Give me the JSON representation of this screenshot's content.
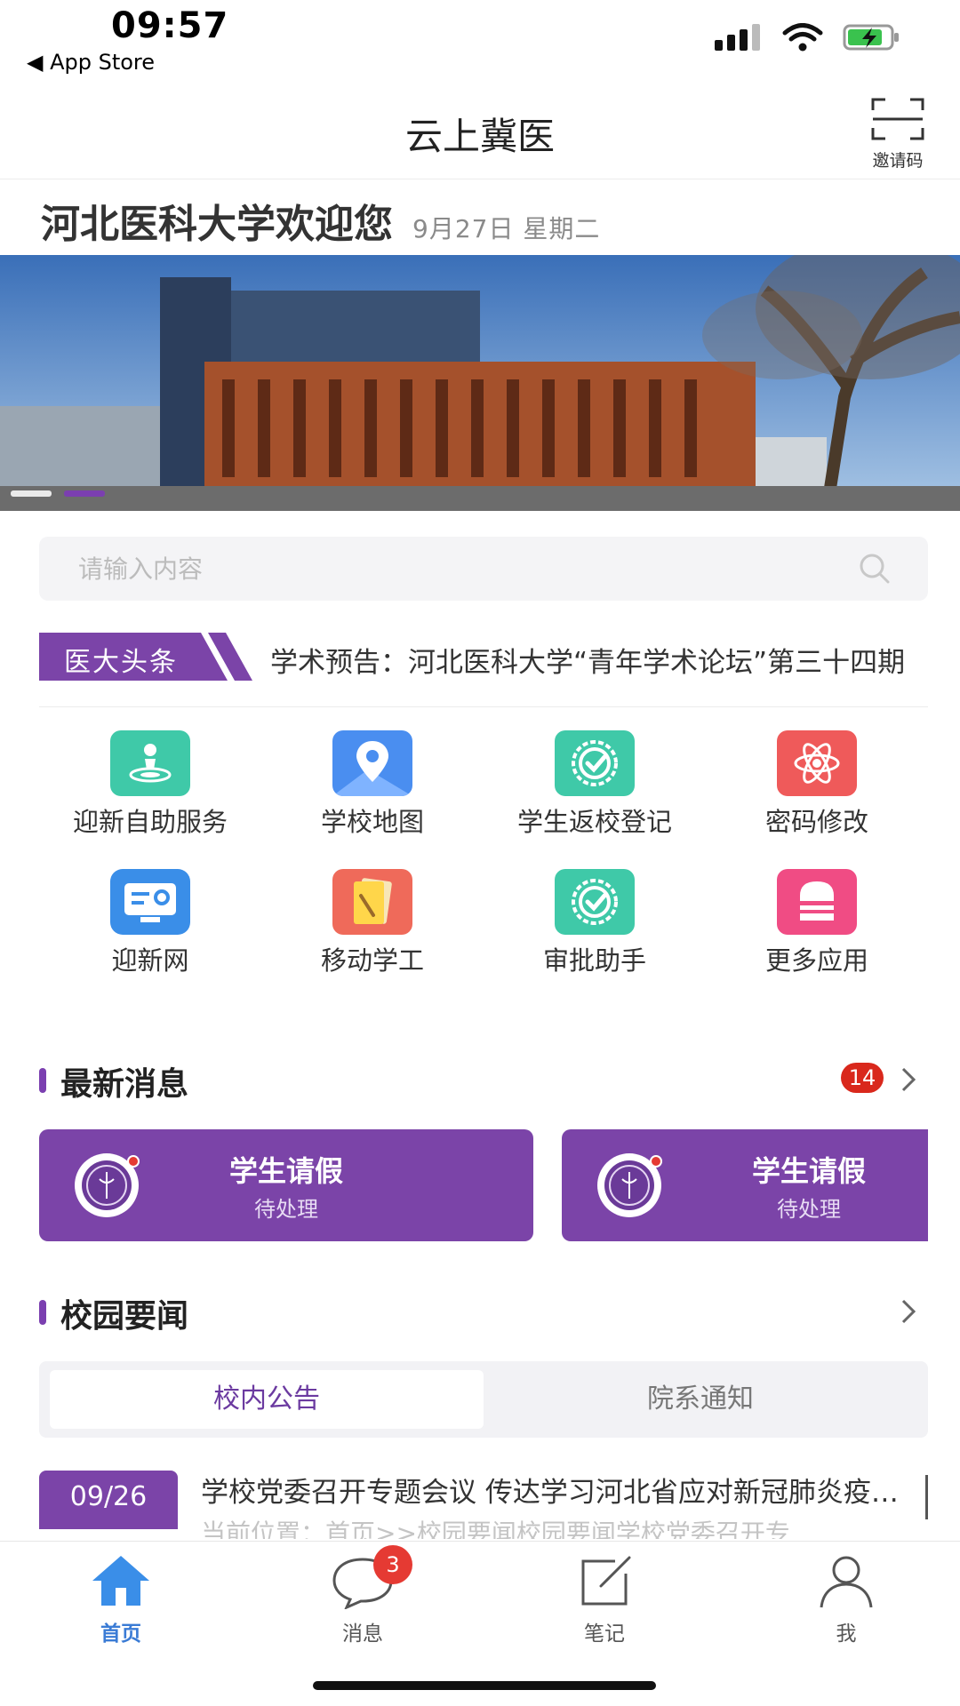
{
  "status_bar": {
    "time": "09:57",
    "back_label": "◀ App Store"
  },
  "nav": {
    "title": "云上冀医",
    "scan_label": "邀请码"
  },
  "welcome": {
    "title": "河北医科大学欢迎您",
    "date": "9月27日  星期二"
  },
  "banner": {
    "active_slide": 2,
    "slides": 2
  },
  "search": {
    "placeholder": "请输入内容"
  },
  "headline": {
    "tag": "医大头条",
    "text": "学术预告：河北医科大学“青年学术论坛”第三十四期"
  },
  "apps": [
    {
      "label": "迎新自助服务",
      "icon": "checkin-location-icon",
      "color": "#3fc9a8"
    },
    {
      "label": "学校地图",
      "icon": "map-pin-icon",
      "color": "#4a8ef0"
    },
    {
      "label": "学生返校登记",
      "icon": "badge-check-icon",
      "color": "#3fc9a8"
    },
    {
      "label": "密码修改",
      "icon": "atom-icon",
      "color": "#ef5a5a"
    },
    {
      "label": "迎新网",
      "icon": "monitor-settings-icon",
      "color": "#3a8ee8"
    },
    {
      "label": "移动学工",
      "icon": "notes-pencil-icon",
      "color": "#ef6a5a"
    },
    {
      "label": "审批助手",
      "icon": "badge-check-icon",
      "color": "#3fc9a8"
    },
    {
      "label": "更多应用",
      "icon": "briefcase-icon",
      "color": "#f04c84"
    }
  ],
  "messages": {
    "title": "最新消息",
    "unread": "14",
    "cards": [
      {
        "title": "学生请假",
        "status": "待处理"
      },
      {
        "title": "学生请假",
        "status": "待处理"
      }
    ]
  },
  "campus_news": {
    "title": "校园要闻",
    "tabs": [
      {
        "label": "校内公告",
        "active": true
      },
      {
        "label": "院系通知",
        "active": false
      }
    ],
    "items": [
      {
        "date": "09/26",
        "title": "学校党委召开专题会议 传达学习河北省应对新冠肺炎疫情工作",
        "excerpt": "当前位置：首页>>校园要闻校园要闻学校党委召开专"
      }
    ]
  },
  "tab_bar": {
    "items": [
      {
        "label": "首页",
        "icon": "home-icon",
        "active": true
      },
      {
        "label": "消息",
        "icon": "chat-bubble-icon",
        "active": false,
        "badge": "3"
      },
      {
        "label": "笔记",
        "icon": "edit-note-icon",
        "active": false
      },
      {
        "label": "我",
        "icon": "user-icon",
        "active": false
      }
    ]
  },
  "colors": {
    "accent": "#7b44a8",
    "tab_active": "#3a7bd5",
    "badge": "#d9281c"
  }
}
